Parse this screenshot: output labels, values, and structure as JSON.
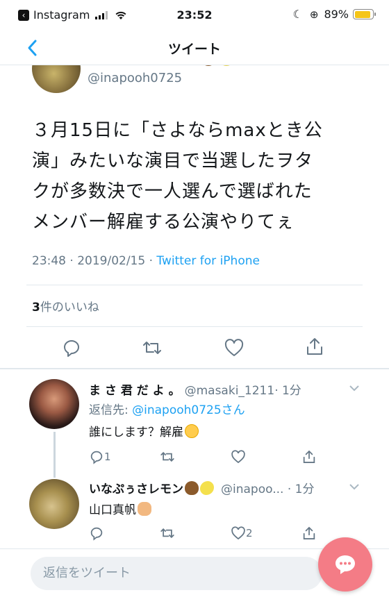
{
  "status_bar": {
    "back_app": "Instagram",
    "time": "23:52",
    "battery": "89%",
    "battery_level": 0.89,
    "battery_color": "#f5c518"
  },
  "nav": {
    "title": "ツイート",
    "back_icon": "chevron-left-icon"
  },
  "tweet": {
    "handle": "@inapooh0725",
    "text_lines": [
      "３月15日に「さよならmaxとき公",
      "演」みたいな演目で当選したヲタ",
      "クが多数決で一人選んで選ばれた",
      "メンバー解雇する公演やりてぇ"
    ],
    "time": "23:48 · 2019/02/15 · ",
    "source": "Twitter for iPhone",
    "likes_count": "3",
    "likes_label": "件のいいね"
  },
  "replies": [
    {
      "name": "ま さ 君 だ よ 。",
      "handle": "@masaki_1211",
      "time": "· 1分",
      "reply_to_label": "返信先: ",
      "reply_to_mention": "@inapooh0725さん",
      "body": "誰にします？解雇",
      "reply_count": "1",
      "like_count": ""
    },
    {
      "name": "いなぷぅさレモン",
      "handle": "@inapoo...",
      "time": " · 1分",
      "body": "山口真帆",
      "reply_count": "",
      "like_count": "2"
    }
  ],
  "compose": {
    "placeholder": "返信をツイート"
  },
  "colors": {
    "accent": "#1da1f2",
    "secondary_text": "#657786",
    "fab": "#f47c86"
  }
}
